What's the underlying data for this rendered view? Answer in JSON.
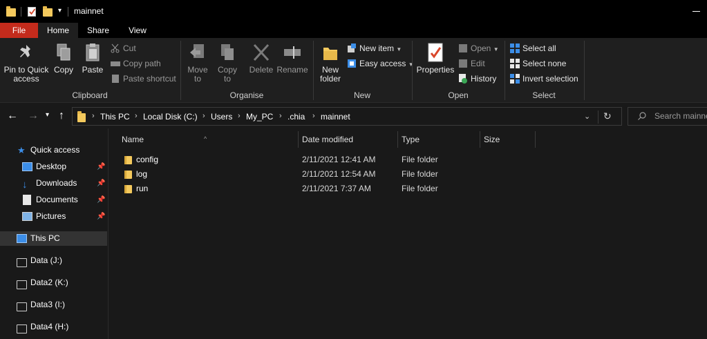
{
  "window": {
    "title": "mainnet"
  },
  "tabs": {
    "file": "File",
    "home": "Home",
    "share": "Share",
    "view": "View"
  },
  "ribbon": {
    "clipboard": {
      "label": "Clipboard",
      "pin": "Pin to Quick access",
      "copy": "Copy",
      "paste": "Paste",
      "cut": "Cut",
      "copy_path": "Copy path",
      "paste_shortcut": "Paste shortcut"
    },
    "organise": {
      "label": "Organise",
      "move_to": "Move to",
      "copy_to": "Copy to",
      "delete": "Delete",
      "rename": "Rename"
    },
    "new": {
      "label": "New",
      "new_folder": "New folder",
      "new_item": "New item",
      "easy_access": "Easy access"
    },
    "open": {
      "label": "Open",
      "properties": "Properties",
      "open": "Open",
      "edit": "Edit",
      "history": "History"
    },
    "select": {
      "label": "Select",
      "select_all": "Select all",
      "select_none": "Select none",
      "invert_selection": "Invert selection"
    }
  },
  "address": {
    "breadcrumbs": [
      "This PC",
      "Local Disk (C:)",
      "Users",
      "My_PC",
      ".chia",
      "mainnet"
    ]
  },
  "search": {
    "placeholder": "Search mainnet"
  },
  "sidebar": {
    "quick_access": "Quick access",
    "pinned": [
      "Desktop",
      "Downloads",
      "Documents",
      "Pictures"
    ],
    "this_pc": "This PC",
    "drives": [
      "Data (J:)",
      "Data2 (K:)",
      "Data3 (I:)",
      "Data4 (H:)"
    ]
  },
  "columns": {
    "name": "Name",
    "date": "Date modified",
    "type": "Type",
    "size": "Size"
  },
  "files": [
    {
      "name": "config",
      "date": "2/11/2021 12:41 AM",
      "type": "File folder"
    },
    {
      "name": "log",
      "date": "2/11/2021 12:54 AM",
      "type": "File folder"
    },
    {
      "name": "run",
      "date": "2/11/2021 7:37 AM",
      "type": "File folder"
    }
  ],
  "colors": {
    "file_tab": "#c42b1c",
    "folder": "#f4c95d",
    "accent_blue": "#3c8ee8"
  }
}
